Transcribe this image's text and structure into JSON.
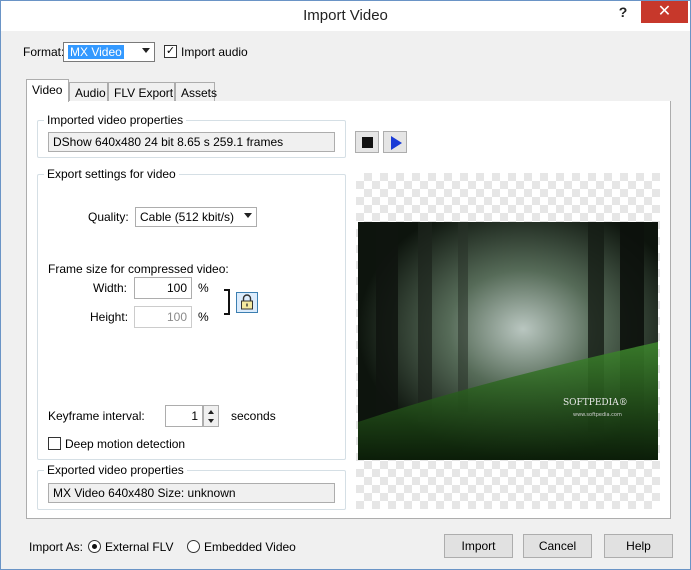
{
  "window": {
    "title": "Import Video",
    "help": "?",
    "close": "✕"
  },
  "top": {
    "format_label": "Format:",
    "format_value": "MX Video",
    "import_audio_label": "Import audio",
    "import_audio_checked": true
  },
  "tabs": [
    {
      "label": "Video",
      "active": true
    },
    {
      "label": "Audio",
      "active": false
    },
    {
      "label": "FLV Export",
      "active": false
    },
    {
      "label": "Assets",
      "active": false
    }
  ],
  "imported": {
    "title": "Imported video properties",
    "value": "DShow 640x480 24 bit 8.65 s 259.1 frames"
  },
  "export": {
    "title": "Export settings for video",
    "quality_label": "Quality:",
    "quality_value": "Cable (512 kbit/s)",
    "frame_size_label": "Frame size for compressed video:",
    "width_label": "Width:",
    "width_value": "100",
    "height_label": "Height:",
    "height_value": "100",
    "percent": "%",
    "keyframe_label": "Keyframe interval:",
    "keyframe_value": "1",
    "seconds_label": "seconds",
    "deep_motion_label": "Deep motion detection",
    "deep_motion_checked": false
  },
  "exported": {
    "title": "Exported video properties",
    "value": "MX Video 640x480 Size: unknown"
  },
  "preview": {
    "watermark": "SOFTPEDIA®",
    "watermark_url": "www.softpedia.com"
  },
  "bottom": {
    "import_as_label": "Import As:",
    "option_external": "External FLV",
    "option_embedded": "Embedded Video",
    "selected": "External FLV",
    "import_button": "Import",
    "cancel_button": "Cancel",
    "help_button": "Help"
  }
}
